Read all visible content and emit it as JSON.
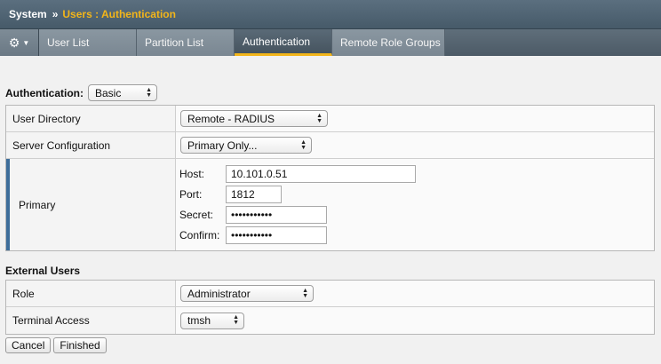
{
  "header": {
    "root": "System",
    "separator": "»",
    "current": "Users : Authentication"
  },
  "tabs": {
    "gear_icon": "gear-icon",
    "items": [
      {
        "label": "User List"
      },
      {
        "label": "Partition List"
      },
      {
        "label": "Authentication",
        "active": true
      },
      {
        "label": "Remote Role Groups"
      }
    ]
  },
  "authentication": {
    "label": "Authentication:",
    "selected": "Basic"
  },
  "settings": {
    "user_directory": {
      "label": "User Directory",
      "selected": "Remote - RADIUS"
    },
    "server_configuration": {
      "label": "Server Configuration",
      "selected": "Primary Only..."
    },
    "primary": {
      "label": "Primary",
      "host_label": "Host:",
      "host_value": "10.101.0.51",
      "port_label": "Port:",
      "port_value": "1812",
      "secret_label": "Secret:",
      "secret_value": "•••••••••••",
      "confirm_label": "Confirm:",
      "confirm_value": "•••••••••••"
    }
  },
  "external_users": {
    "title": "External Users",
    "role": {
      "label": "Role",
      "selected": "Administrator"
    },
    "terminal_access": {
      "label": "Terminal Access",
      "selected": "tmsh"
    }
  },
  "buttons": {
    "cancel": "Cancel",
    "finished": "Finished"
  },
  "colors": {
    "accent": "#f2b51a",
    "header_bg": "#4f6272",
    "primary_marker": "#3d6d9a"
  }
}
